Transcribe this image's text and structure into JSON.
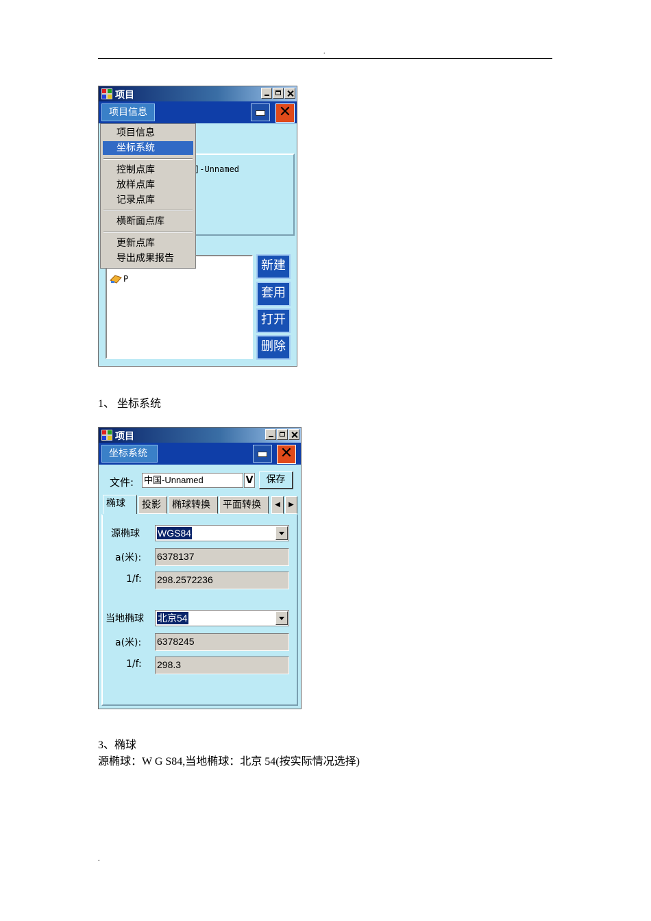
{
  "page": {
    "header_mark": ".",
    "footer_mark": "."
  },
  "window1": {
    "title": "项目",
    "menu_title": "项目信息",
    "menu_items": [
      "项目信息",
      "坐标系统",
      "控制点库",
      "放样点库",
      "记录点库",
      "横断面点库",
      "更新点库",
      "导出成果报告"
    ],
    "selected_menu_item": "坐标系统",
    "project_text": "]-Unnamed",
    "list_item": "P",
    "buttons": {
      "new": "新建",
      "apply": "套用",
      "open": "打开",
      "delete": "删除"
    },
    "close_glyph": "✕"
  },
  "caption1": "1、 坐标系统",
  "window2": {
    "title": "项目",
    "menu_title": "坐标系统",
    "file_label": "文件:",
    "file_value": "中国-Unnamed",
    "file_drop_glyph": "V",
    "save_label": "保存",
    "tabs": [
      "椭球",
      "投影",
      "椭球转换",
      "平面转换"
    ],
    "active_tab": "椭球",
    "source": {
      "label": "源椭球",
      "value": "WGS84",
      "a_label": "a(米):",
      "a_value": "6378137",
      "f_label": "1/f:",
      "f_value": "298.2572236"
    },
    "local": {
      "label": "当地椭球",
      "value": "北京54",
      "a_label": "a(米):",
      "a_value": "6378245",
      "f_label": "1/f:",
      "f_value": "298.3"
    },
    "close_glyph": "✕"
  },
  "caption2": "3、椭球",
  "caption3": "源椭球：W G S84,当地椭球：北京 54(按实际情况选择)"
}
